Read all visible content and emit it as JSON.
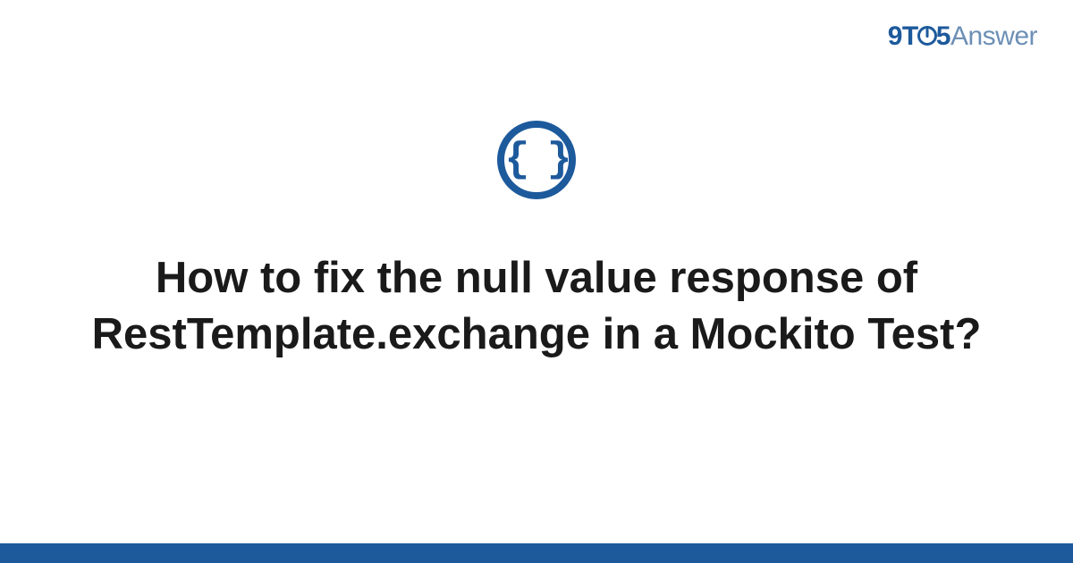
{
  "logo": {
    "part1": "9T",
    "part2": "5",
    "part3": "Answer"
  },
  "icon": {
    "braces": "{ }"
  },
  "title": "How to fix the null value response of RestTemplate.exchange in a Mockito Test?",
  "colors": {
    "primary": "#1d5a9c",
    "secondary": "#6c8fb5"
  }
}
